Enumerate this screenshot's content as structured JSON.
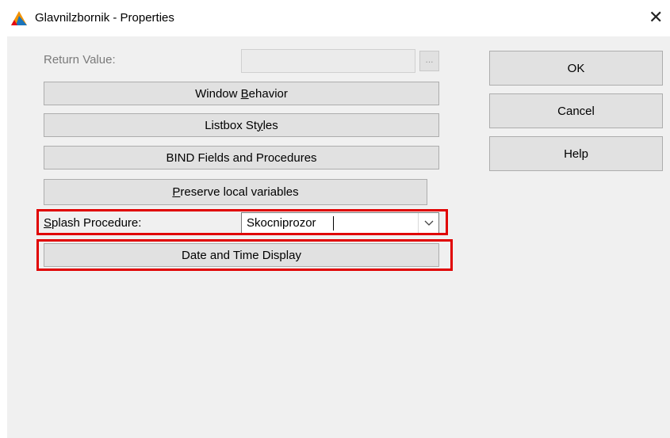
{
  "window": {
    "title": "Glavnilzbornik - Properties",
    "close_glyph": "✕"
  },
  "return_value": {
    "label": "Return Value:",
    "value": "",
    "browse_label": "..."
  },
  "buttons": {
    "window_behavior": {
      "pre": "Window ",
      "accel": "B",
      "post": "ehavior"
    },
    "listbox_styles": {
      "pre": "Listbox St",
      "accel": "y",
      "post": "les"
    },
    "bind_fields": "BIND Fields and Procedures",
    "preserve_locals": {
      "pre": "",
      "accel": "P",
      "post": "reserve local variables"
    },
    "date_time": "Date and Time Display"
  },
  "splash": {
    "label_accel": "S",
    "label_rest": "plash Procedure:",
    "value": "Skocniprozor"
  },
  "dialog_buttons": {
    "ok": "OK",
    "cancel": "Cancel",
    "help": "Help"
  },
  "colors": {
    "highlight": "#e00000",
    "client_bg": "#f0f0f0",
    "button_bg": "#e1e1e1"
  },
  "icons": [
    "app-logo-icon",
    "close-icon",
    "ellipsis-icon",
    "dropdown-chevron-icon"
  ]
}
